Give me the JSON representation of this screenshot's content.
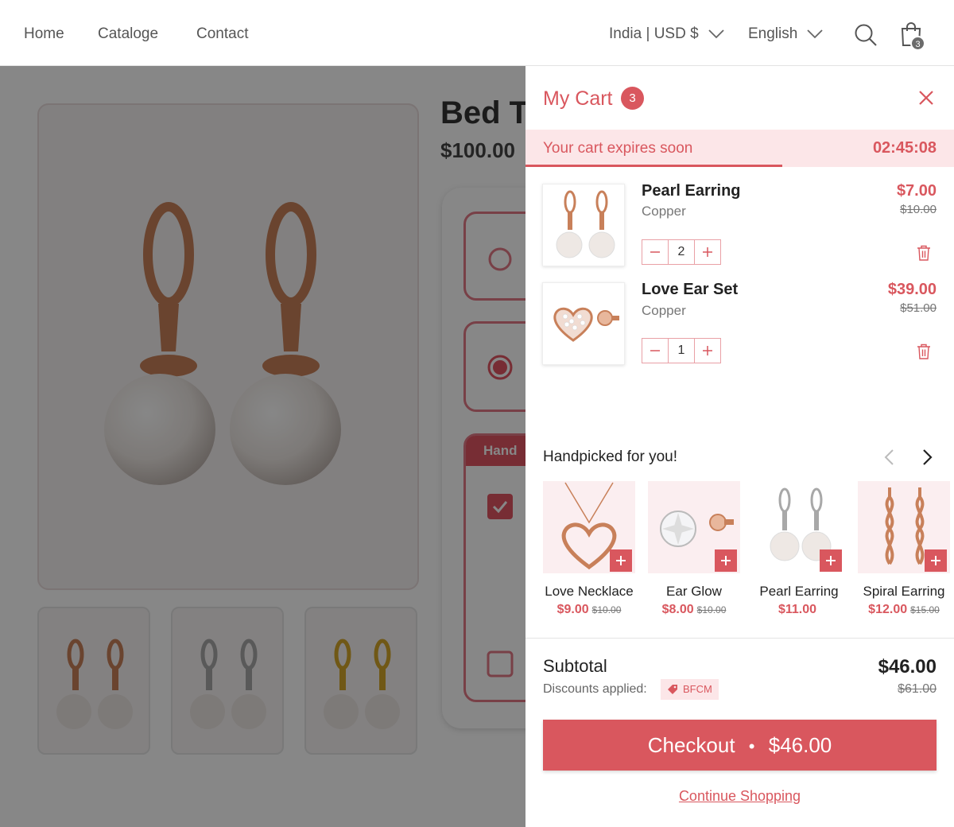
{
  "header": {
    "nav": [
      "Home",
      "Cataloge",
      "Contact"
    ],
    "region": "India | USD $",
    "language": "English",
    "bag_count": "3"
  },
  "product_page": {
    "title": "Bed T",
    "price": "$100.00",
    "option_heading": "Hand"
  },
  "cart": {
    "title": "My Cart",
    "count": "3",
    "expiry_text": "Your cart expires soon",
    "expiry_timer": "02:45:08",
    "expiry_progress": 0.6,
    "items": [
      {
        "name": "Pearl Earring",
        "variant": "Copper",
        "price": "$7.00",
        "old_price": "$10.00",
        "qty": "2"
      },
      {
        "name": "Love Ear Set",
        "variant": "Copper",
        "price": "$39.00",
        "old_price": "$51.00",
        "qty": "1"
      }
    ],
    "picks_title": "Handpicked for you!",
    "picks": [
      {
        "name": "Love Necklace",
        "price": "$9.00",
        "old_price": "$10.00"
      },
      {
        "name": "Ear Glow",
        "price": "$8.00",
        "old_price": "$10.00"
      },
      {
        "name": "Pearl Earring",
        "price": "$11.00",
        "old_price": ""
      },
      {
        "name": "Spiral Earring",
        "price": "$12.00",
        "old_price": "$15.00"
      }
    ],
    "subtotal_label": "Subtotal",
    "subtotal": "$46.00",
    "subtotal_old": "$61.00",
    "discounts_label": "Discounts applied:",
    "discount_code": "BFCM",
    "checkout_label": "Checkout",
    "checkout_amount": "$46.00",
    "continue_label": "Continue Shopping"
  },
  "colors": {
    "accent": "#d9575e",
    "accent_light": "#fce6e8",
    "copper": "#c8805a",
    "silver": "#a8a8a8",
    "gold": "#d4a62a"
  }
}
